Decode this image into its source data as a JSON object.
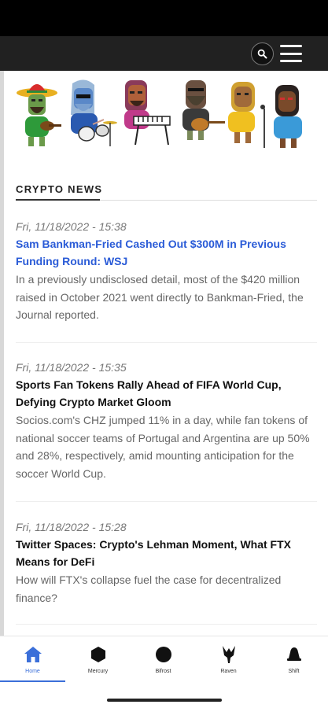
{
  "header": {
    "search_icon": "search-icon",
    "menu_icon": "hamburger-menu-icon"
  },
  "colors": {
    "header_bg": "#212121",
    "link_blue": "#2a5bd7",
    "nav_active": "#3b6fd9"
  },
  "section": {
    "title": "CRYPTO NEWS"
  },
  "articles": [
    {
      "date": "Fri, 11/18/2022 - 15:38",
      "headline": "Sam Bankman-Fried Cashed Out $300M in Previous Funding Round: WSJ",
      "summary": "In a previously undisclosed detail, most of the $420 million raised in October 2021 went directly to Bankman-Fried, the Journal reported."
    },
    {
      "date": "Fri, 11/18/2022 - 15:35",
      "headline": "Sports Fan Tokens Rally Ahead of FIFA World Cup, Defying Crypto Market Gloom",
      "summary": "Socios.com's CHZ jumped 11% in a day, while fan tokens of national soccer teams of Portugal and Argentina are up 50% and 28%, respectively, amid mounting anticipation for the soccer World Cup."
    },
    {
      "date": "Fri, 11/18/2022 - 15:28",
      "headline": "Twitter Spaces: Crypto's Lehman Moment, What FTX Means for DeFi",
      "summary": "How will FTX's collapse fuel the case for decentralized finance?"
    }
  ],
  "nav": [
    {
      "label": "Home",
      "icon": "home-icon"
    },
    {
      "label": "Mercury",
      "icon": "hexagon-icon"
    },
    {
      "label": "Bifrost",
      "icon": "circle-icon"
    },
    {
      "label": "Raven",
      "icon": "raven-icon"
    },
    {
      "label": "Shift",
      "icon": "bell-icon"
    }
  ]
}
